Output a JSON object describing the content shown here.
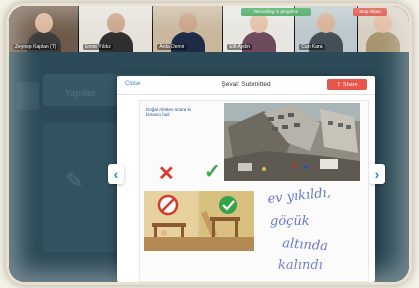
{
  "video_strip": {
    "participants": [
      {
        "name": "Zeynep Kaplan (T)",
        "bg": "#6e5a4a",
        "skin": "#d9b59a",
        "shirt": "#3b3b3b"
      },
      {
        "name": "Emre Yıldız",
        "bg": "#e6e2da",
        "skin": "#caa58a",
        "shirt": "#2f2f2f"
      },
      {
        "name": "Arda Demir",
        "bg": "#c9b89e",
        "skin": "#c8a184",
        "shirt": "#1e2b47"
      },
      {
        "name": "Elif Aydın",
        "bg": "#e8e6e1",
        "skin": "#e2c0a6",
        "shirt": "#6d4a5c"
      },
      {
        "name": "Can Kara",
        "bg": "#bcc8cc",
        "skin": "#d6b092",
        "shirt": "#434f57"
      },
      {
        "name": "",
        "bg": "#d7cfc2",
        "skin": "#e0bda0",
        "shirt": "#a8946e"
      }
    ],
    "recording_label": "Recording in progress",
    "stop_label": "Stop share"
  },
  "background": {
    "page_heading": "Yapılan"
  },
  "modal": {
    "close_label": "Close",
    "title": "Şeval: Submitted",
    "share_label": "Share",
    "prev_glyph": "‹",
    "next_glyph": "›"
  },
  "submission": {
    "question": "Doğal Afetten sonra ki binanın hali",
    "handwriting": [
      "ev yıkıldı,",
      "göçük",
      "altında",
      "kalındı"
    ],
    "wrong_mark": "✕",
    "right_mark": "✓"
  },
  "colors": {
    "accent": "#e8554b",
    "link": "#3f7fd0",
    "wrong": "#e0332b",
    "right": "#3aa84a"
  }
}
